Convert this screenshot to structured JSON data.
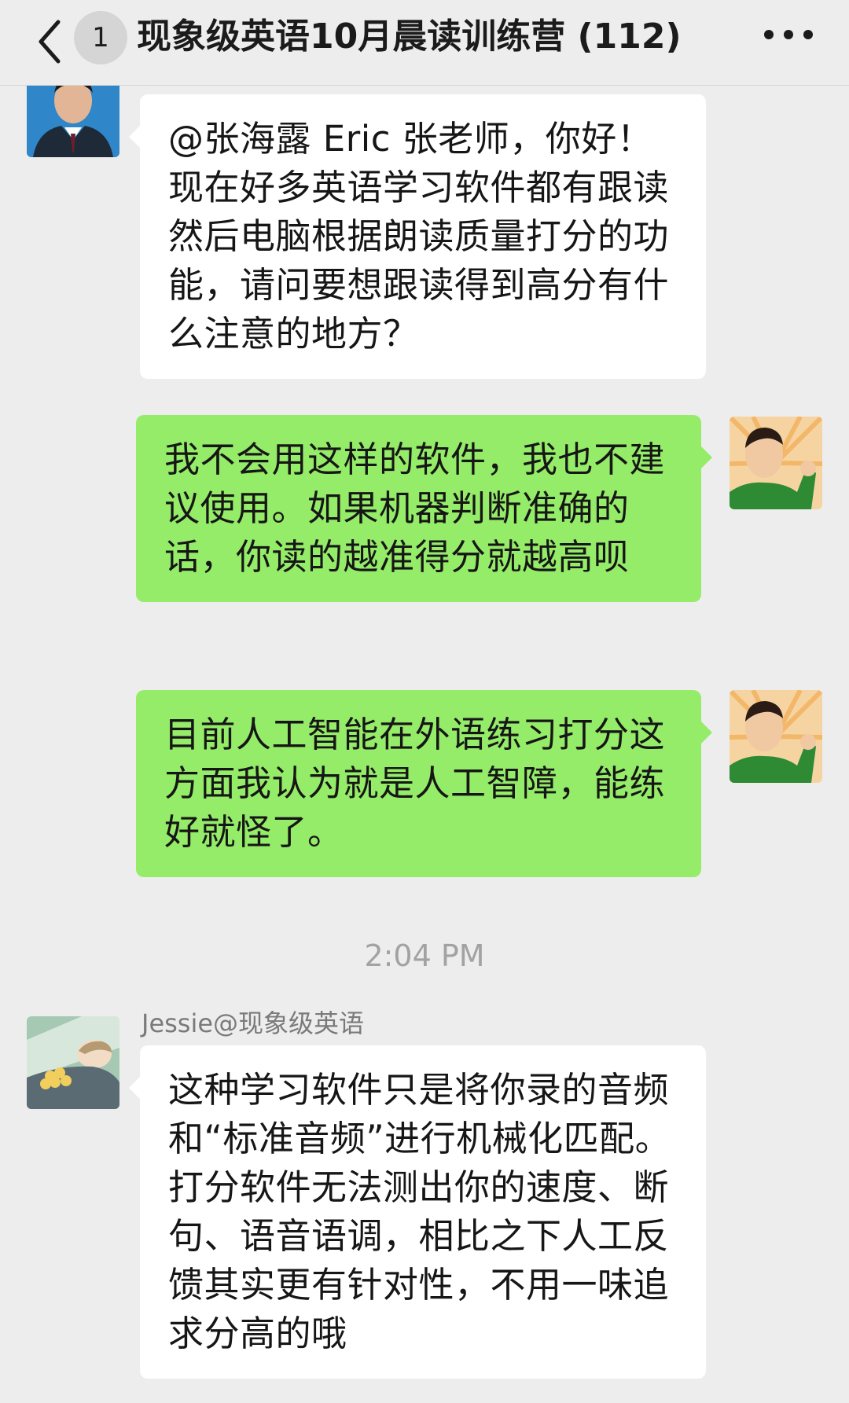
{
  "header": {
    "unread_count": "1",
    "title": "现象级英语10月晨读训练营 (112)"
  },
  "icons": {
    "back": "chevron-left-icon",
    "more": "more-dots-icon"
  },
  "messages": [
    {
      "text": "@张海露 Eric 张老师，你好！现在好多英语学习软件都有跟读然后电脑根据朗读质量打分的功能，请问要想跟读得到高分有什么注意的地方？"
    },
    {
      "text": "我不会用这样的软件，我也不建议使用。如果机器判断准确的话，你读的越准得分就越高呗"
    },
    {
      "text": "目前人工智能在外语练习打分这方面我认为就是人工智障，能练好就怪了。"
    },
    {
      "sender": "Jessie@现象级英语",
      "text": "这种学习软件只是将你录的音频和“标准音频”进行机械化匹配。打分软件无法测出你的速度、断句、语音语调，相比之下人工反馈其实更有针对性，不用一味追求分高的哦"
    }
  ],
  "timestamp": "2:04 PM",
  "colors": {
    "background": "#ededed",
    "incoming_bubble": "#ffffff",
    "outgoing_bubble": "#95ec69"
  }
}
